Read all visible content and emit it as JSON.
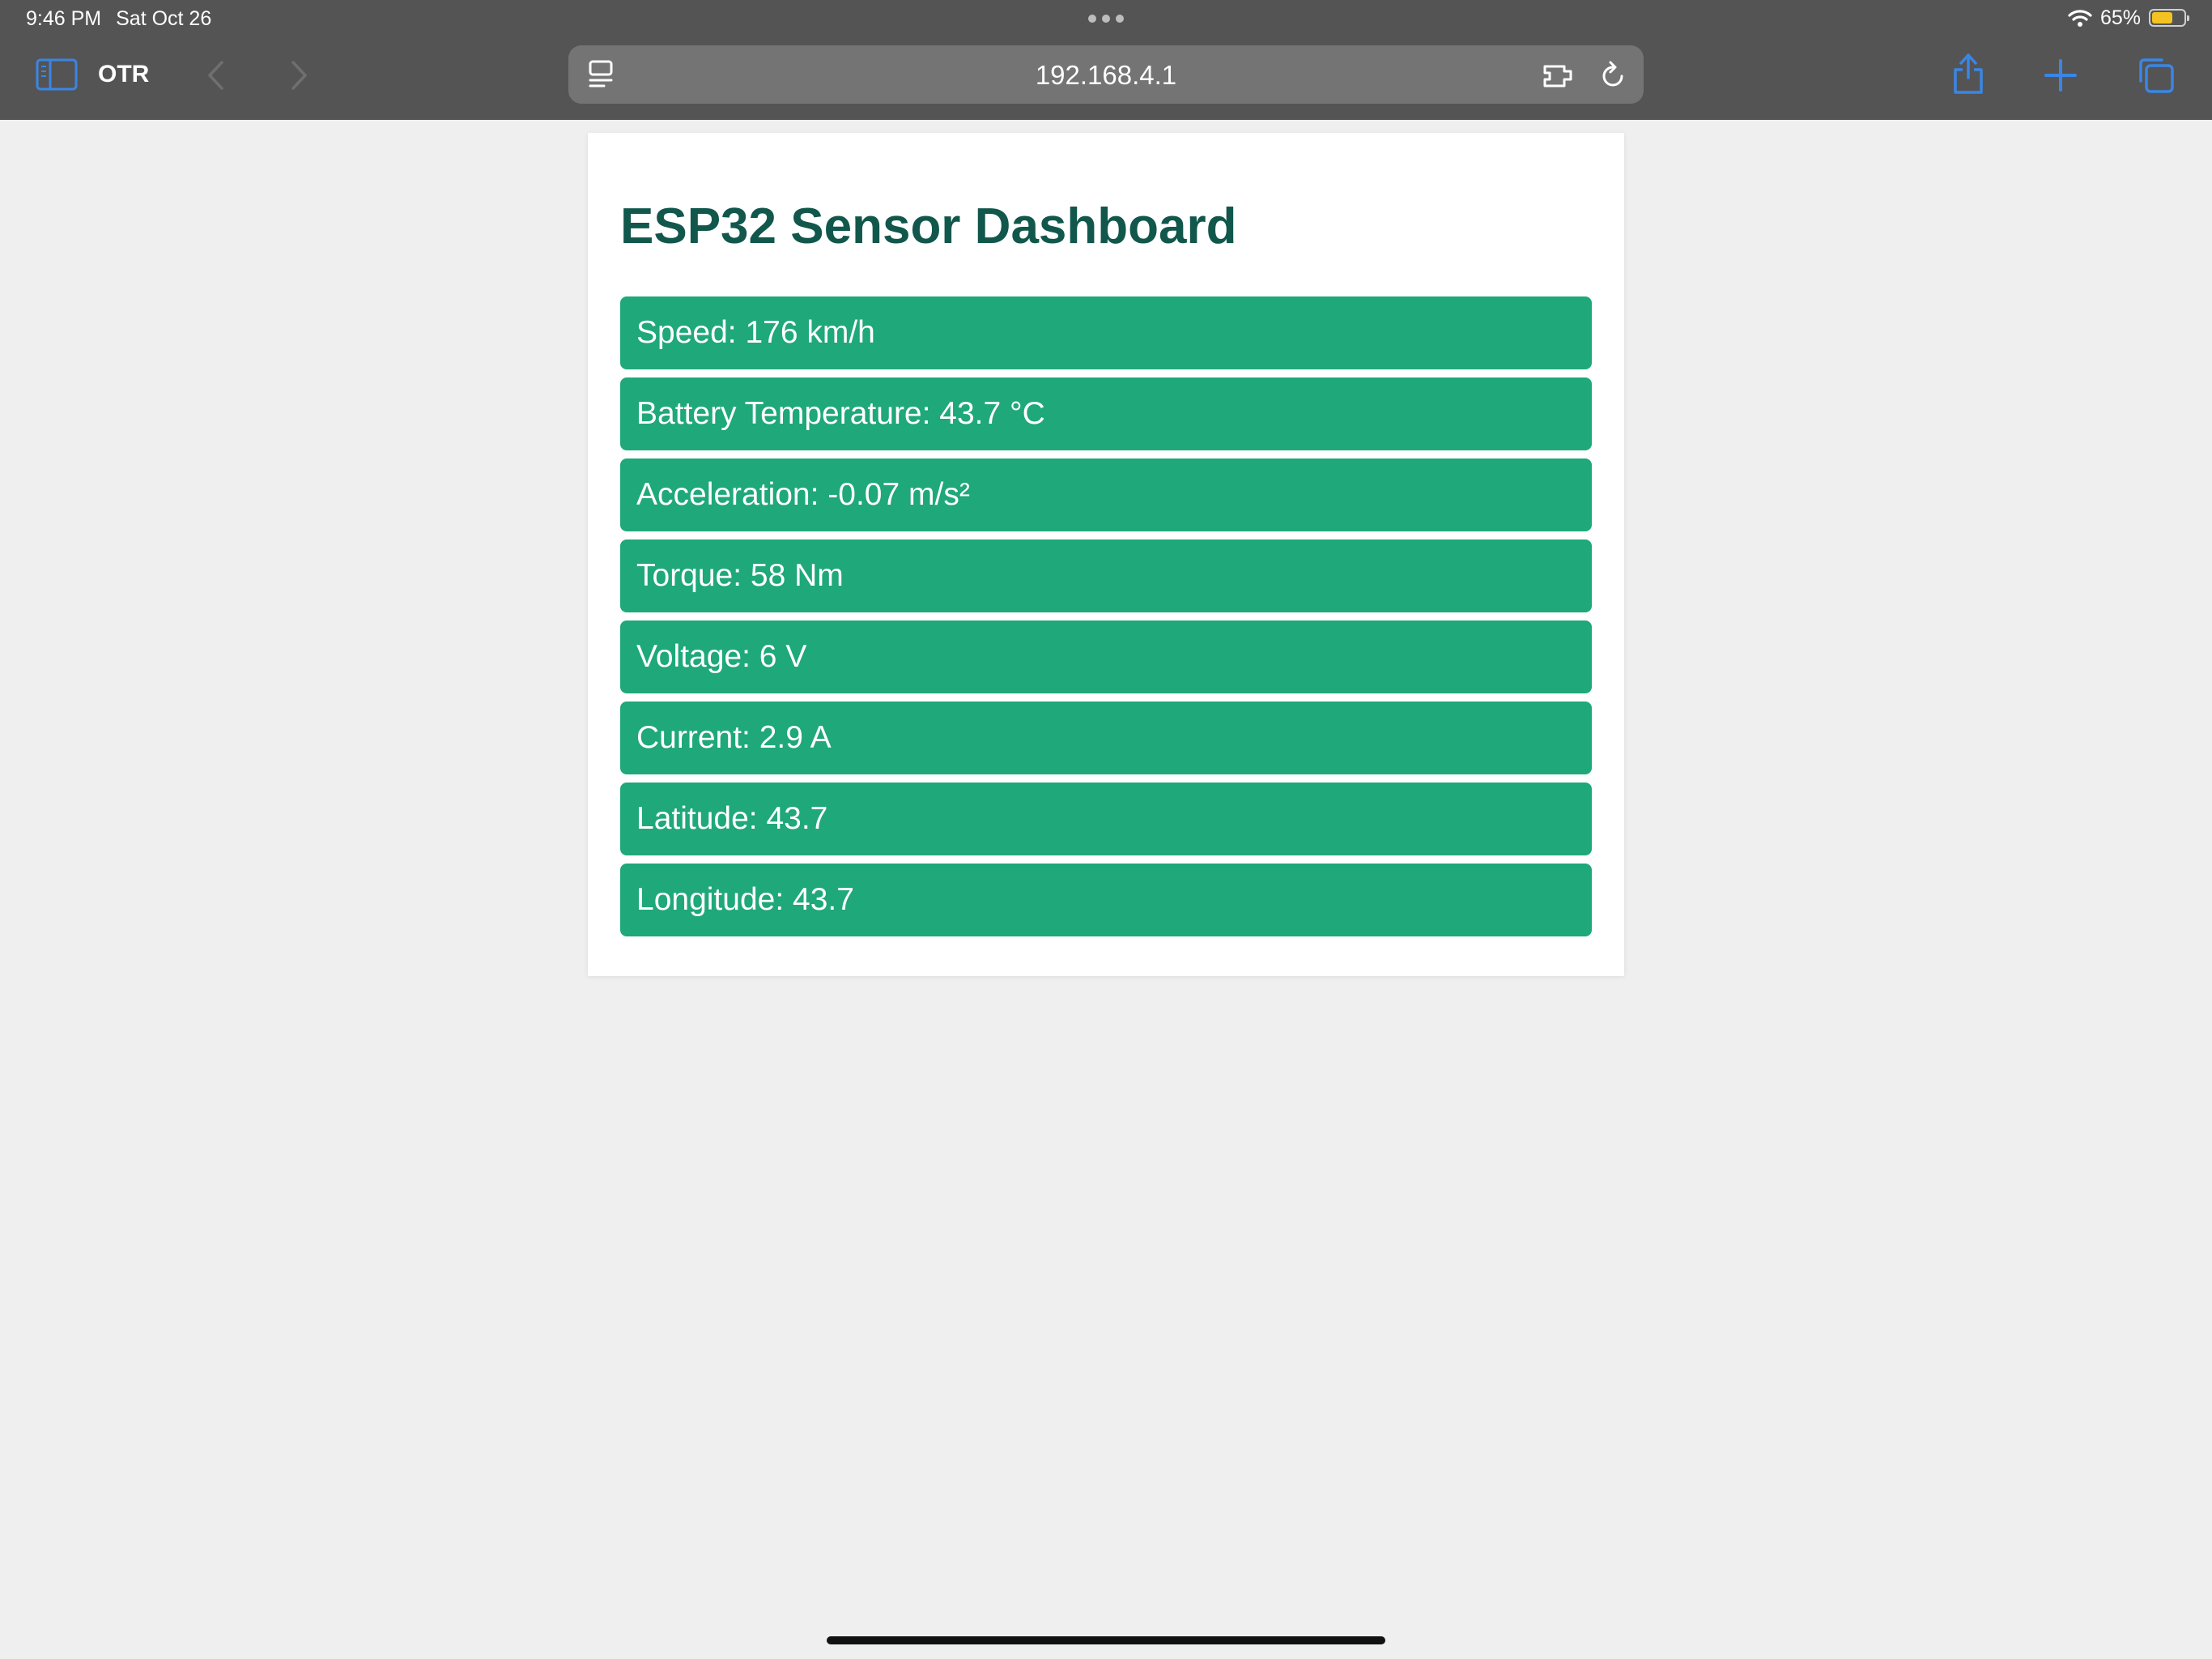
{
  "status_bar": {
    "time": "9:46 PM",
    "date": "Sat Oct 26",
    "battery": "65%",
    "battery_level": 0.65
  },
  "toolbar": {
    "app_name": "OTR",
    "url": "192.168.4.1",
    "accent_color": "#2f7fe0",
    "icons": [
      "sidebar-icon",
      "back-icon",
      "forward-icon",
      "reader-icon",
      "extension-icon",
      "reload-icon",
      "share-icon",
      "new-tab-icon",
      "tabs-icon"
    ]
  },
  "page": {
    "title": "ESP32 Sensor Dashboard",
    "title_color": "#11574c",
    "reading_color": "#1fa87a",
    "readings": [
      "Speed: 176 km/h",
      "Battery Temperature: 43.7 °C",
      "Acceleration: -0.07 m/s²",
      "Torque: 58 Nm",
      "Voltage: 6 V",
      "Current: 2.9 A",
      "Latitude: 43.7",
      "Longitude: 43.7"
    ]
  }
}
